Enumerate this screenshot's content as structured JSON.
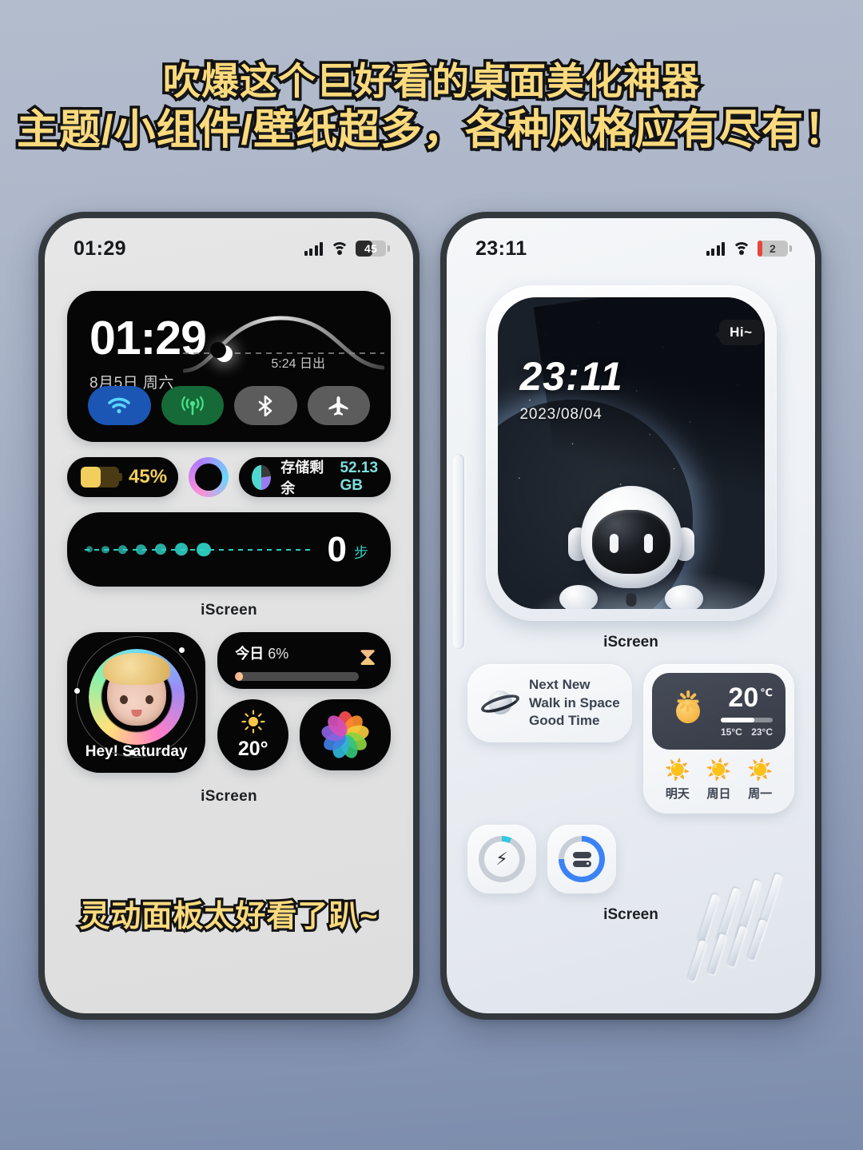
{
  "headline": {
    "line1": "吹爆这个巨好看的桌面美化神器",
    "line2": "主题/小组件/壁纸超多，各种风格应有尽有！",
    "accent_color": "#fbda7d",
    "stroke_color": "#111111"
  },
  "caption": "灵动面板太好看了趴~",
  "left_phone": {
    "status_bar": {
      "time": "01:29",
      "signal_icon": "signal-bars-icon",
      "wifi_icon": "wifi-icon",
      "battery_level": "45",
      "battery_fill_color": "#2b2b2b",
      "battery_fill_pct": 55
    },
    "clock_widget": {
      "time": "01:29",
      "date": "8月5日 周六",
      "sunrise": "5:24 日出",
      "moon_icon": "crescent-moon-icon",
      "toggles": [
        {
          "name": "wifi-toggle",
          "icon": "wifi-icon",
          "color": "#1b56b5"
        },
        {
          "name": "cellular-toggle",
          "icon": "cellular-signal-icon",
          "color": "#156a38"
        },
        {
          "name": "bluetooth-toggle",
          "icon": "bluetooth-icon",
          "color": "#5c5c5c"
        },
        {
          "name": "airplane-toggle",
          "icon": "airplane-icon",
          "color": "#5c5c5c"
        }
      ]
    },
    "battery_pill": {
      "percent": "45%",
      "fill_pct": 52,
      "color": "#f2ce5c"
    },
    "ring_button": {
      "icon": "gradient-ring-icon"
    },
    "storage_pill": {
      "icon": "pie-chart-icon",
      "label": "存储剩余",
      "value": "52.13 GB",
      "value_color": "#7de0de"
    },
    "steps_widget": {
      "count": "0",
      "unit": "步",
      "dot_color": "#2ecfc2",
      "dot_count": 7
    },
    "tag_top": "iScreen",
    "tag_bottom": "iScreen",
    "memoji_widget": {
      "label": "Hey! Saturday",
      "icon": "memoji-face-icon",
      "orbit_dots": 3
    },
    "today_widget": {
      "label": "今日",
      "percent": "6%",
      "progress_pct": 6,
      "icon": "hourglass-icon",
      "hourglass_glyph": "⧗"
    },
    "temp_widget": {
      "icon": "sun-icon",
      "glyph": "☀",
      "value": "20°"
    },
    "photos_widget": {
      "icon": "photos-app-icon"
    }
  },
  "right_phone": {
    "status_bar": {
      "time": "23:11",
      "signal_icon": "signal-bars-icon",
      "wifi_icon": "wifi-icon",
      "battery_level": "2",
      "battery_fill_color": "#e8463c",
      "battery_fill_pct": 16
    },
    "space_widget": {
      "time": "23:11",
      "date": "2023/08/04",
      "astronaut_icon": "astronaut-icon",
      "speech_bubble": "Hi~",
      "background": "earth-from-space"
    },
    "tag_top": "iScreen",
    "tag_bottom": "iScreen",
    "space_note": {
      "icon": "saturn-planet-icon",
      "line1": "Next New",
      "line2": "Walk in Space",
      "line3": "Good Time"
    },
    "weather_widget": {
      "icon": "sun-icon",
      "temp": "20",
      "unit": "℃",
      "low": "15°C",
      "high": "23°C",
      "bar_pct": 64,
      "forecast": [
        {
          "icon": "sun-emoji-icon",
          "glyph": "☀️",
          "day": "明天"
        },
        {
          "icon": "sun-emoji-icon",
          "glyph": "☀️",
          "day": "周日"
        },
        {
          "icon": "sun-emoji-icon",
          "glyph": "☀️",
          "day": "周一"
        }
      ]
    },
    "battery_ring": {
      "icon": "lightning-bolt-icon",
      "glyph": "⚡",
      "progress_pct": 7,
      "color": "#34c8e0"
    },
    "storage_ring": {
      "icon": "hard-drive-icon",
      "progress_pct": 75,
      "color": "#3b82f6"
    }
  }
}
